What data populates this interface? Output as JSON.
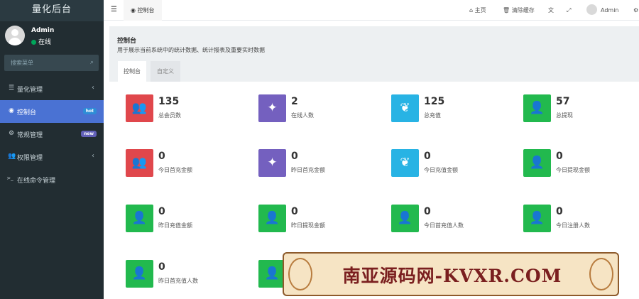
{
  "app": {
    "title": "量化后台"
  },
  "user": {
    "name": "Admin",
    "status": "在线"
  },
  "sidebar": {
    "search_placeholder": "搜索菜单",
    "items": [
      {
        "icon": "list-icon",
        "glyph": "☰",
        "label": "量化管理",
        "has_arrow": true,
        "active": false
      },
      {
        "icon": "dashboard-icon",
        "glyph": "◉",
        "label": "控制台",
        "badge": "hot",
        "active": true
      },
      {
        "icon": "cogs-icon",
        "glyph": "⚙",
        "label": "常规管理",
        "badge": "new",
        "active": false
      },
      {
        "icon": "users-icon",
        "glyph": "👥",
        "label": "权限管理",
        "has_arrow": true,
        "active": false
      },
      {
        "icon": "terminal-icon",
        "glyph": ">_",
        "label": "在线命令管理",
        "active": false
      }
    ]
  },
  "header": {
    "tab_label": "控制台",
    "home": "主页",
    "clear_cache": "清除缓存",
    "admin": "Admin"
  },
  "page": {
    "title": "控制台",
    "description": "用于展示当前系统中的统计数据、统计报表及重要实时数据",
    "tabs": [
      "控制台",
      "自定义"
    ]
  },
  "stats": [
    {
      "value": "135",
      "label": "总会员数",
      "color": "#e0474c",
      "icon": "users-icon"
    },
    {
      "value": "2",
      "label": "在线人数",
      "color": "#7460bf",
      "icon": "magic-icon"
    },
    {
      "value": "125",
      "label": "总充值",
      "color": "#28b3e4",
      "icon": "leaf-icon"
    },
    {
      "value": "57",
      "label": "总提现",
      "color": "#22b94e",
      "icon": "user-icon"
    },
    {
      "value": "0",
      "label": "今日首充金额",
      "color": "#e0474c",
      "icon": "users-icon"
    },
    {
      "value": "0",
      "label": "昨日首充金额",
      "color": "#7460bf",
      "icon": "magic-icon"
    },
    {
      "value": "0",
      "label": "今日充值金额",
      "color": "#28b3e4",
      "icon": "leaf-icon"
    },
    {
      "value": "0",
      "label": "今日提现金额",
      "color": "#22b94e",
      "icon": "user-icon"
    },
    {
      "value": "0",
      "label": "昨日充值金额",
      "color": "#22b94e",
      "icon": "user-icon"
    },
    {
      "value": "0",
      "label": "昨日提现金额",
      "color": "#22b94e",
      "icon": "user-icon"
    },
    {
      "value": "0",
      "label": "今日首充值人数",
      "color": "#22b94e",
      "icon": "user-icon"
    },
    {
      "value": "0",
      "label": "今日注册人数",
      "color": "#22b94e",
      "icon": "user-icon"
    },
    {
      "value": "0",
      "label": "昨日首充值人数",
      "color": "#22b94e",
      "icon": "user-icon"
    }
  ],
  "watermark": "南亚源码网-KVXR.COM"
}
